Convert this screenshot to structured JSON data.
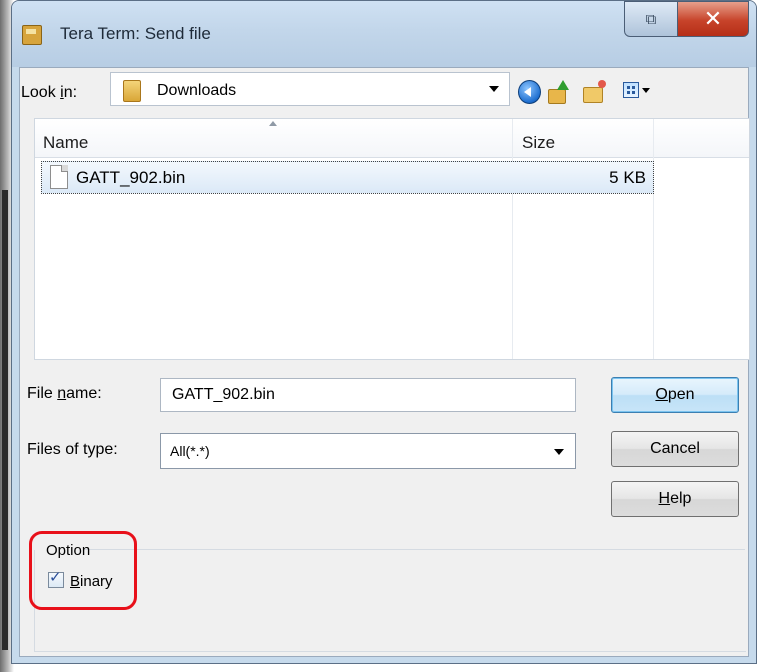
{
  "window": {
    "title": "Tera Term: Send file",
    "restore_glyph": "⧉",
    "close_glyph": "✕"
  },
  "lookin": {
    "label_pre": "Look ",
    "label_accel": "i",
    "label_post": "n:",
    "value": "Downloads"
  },
  "toolbar": {
    "icons": [
      "back-icon",
      "up-folder-icon",
      "new-folder-icon",
      "views-icon"
    ]
  },
  "filelist": {
    "columns": [
      {
        "label": "Name"
      },
      {
        "label": "Size"
      }
    ],
    "rows": [
      {
        "name": "GATT_902.bin",
        "size": "5 KB",
        "selected": true
      }
    ]
  },
  "form": {
    "filename_label_pre": "File ",
    "filename_label_accel": "n",
    "filename_label_post": "ame:",
    "filename_value": "GATT_902.bin",
    "filetype_label": "Files of type:",
    "filetype_value": "All(*.*)"
  },
  "buttons": {
    "open_accel": "O",
    "open_rest": "pen",
    "cancel": "Cancel",
    "help_accel": "H",
    "help_rest": "elp"
  },
  "option": {
    "group_label": "Option",
    "binary_accel": "B",
    "binary_rest": "inary",
    "binary_checked": true,
    "check_glyph": "✓"
  },
  "colors": {
    "highlight": "#e8101a",
    "close_button": "#c7432a",
    "selection": "#dbe9f7"
  }
}
